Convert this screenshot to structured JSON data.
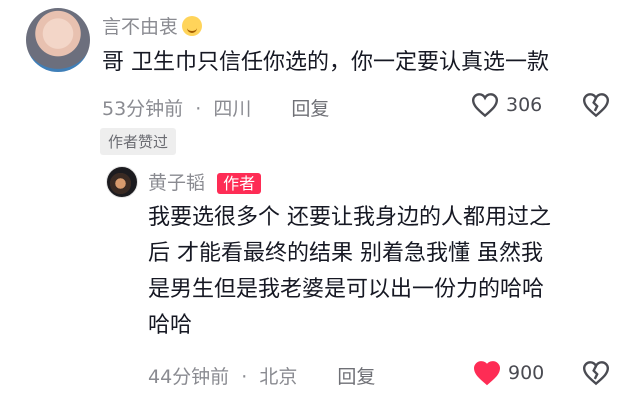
{
  "comment": {
    "user": "言不由衷",
    "text": "哥  卫生巾只信任你选的，你一定要认真选一款",
    "time": "53分钟前",
    "location": "四川",
    "reply_label": "回复",
    "like_count": "306",
    "tag": "作者赞过"
  },
  "reply": {
    "user": "黄子韬",
    "badge": "作者",
    "lines": [
      "我要选很多个 还要让我身边的人都用过之",
      "后 才能看最终的结果 别着急我懂 虽然我",
      "是男生但是我老婆是可以出一份力的哈哈",
      "哈哈"
    ],
    "time": "44分钟前",
    "location": "北京",
    "reply_label": "回复",
    "like_count": "900",
    "liked": true
  },
  "colors": {
    "accent": "#fe2c55",
    "meta": "#8a8b91"
  },
  "icons": {
    "like": "heart-icon",
    "dislike": "broken-heart-icon"
  }
}
